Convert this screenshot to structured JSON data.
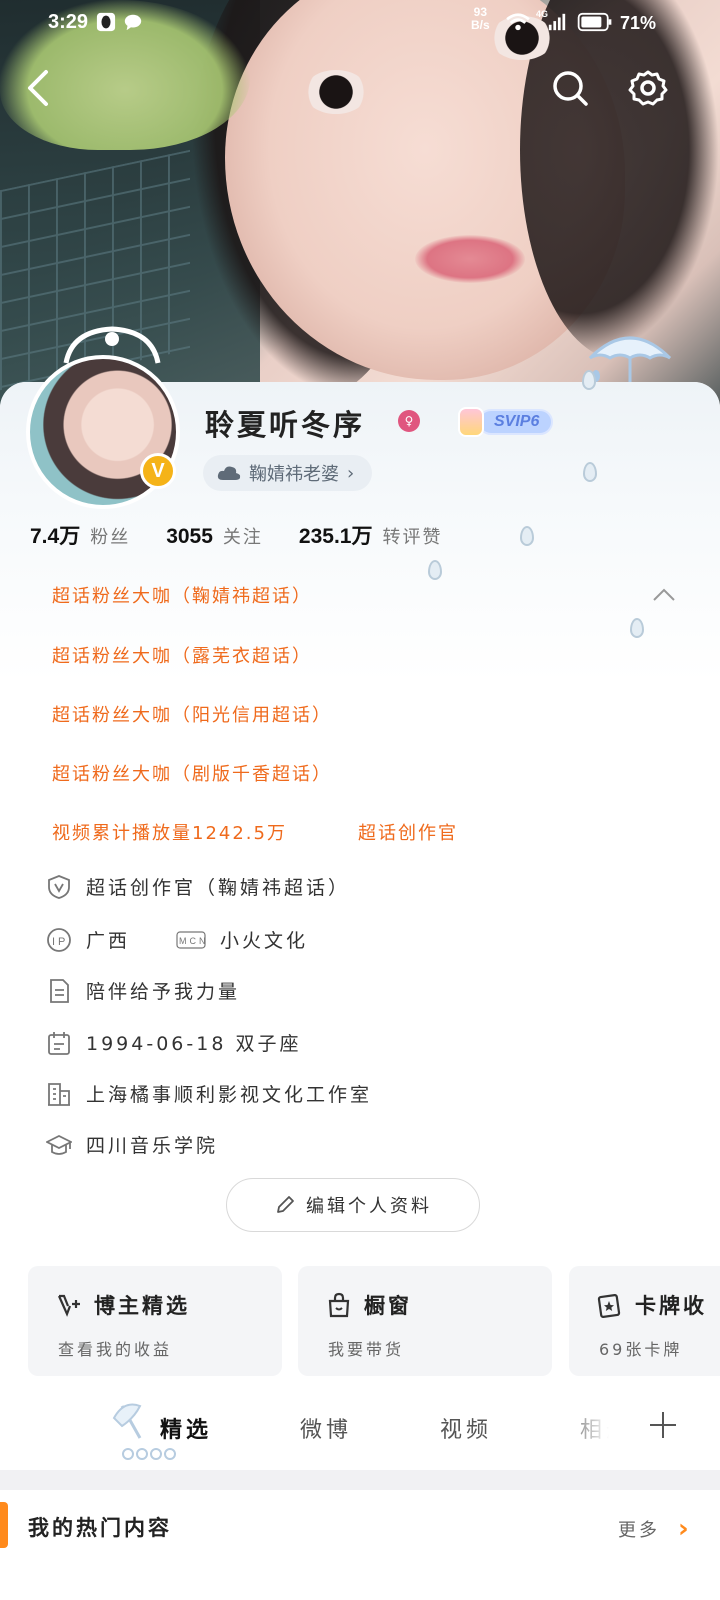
{
  "status_bar": {
    "time": "3:29",
    "net_speed_value": "93",
    "net_speed_unit": "B/s",
    "network_type": "4G",
    "battery": "71%"
  },
  "profile": {
    "username": "聆夏听冬序",
    "vip_label": "SVIP6",
    "verified_mark": "V",
    "group_chip": "鞠婧祎老婆",
    "group_chip_arrow": "›"
  },
  "stats": [
    {
      "value": "7.4万",
      "label": "粉丝"
    },
    {
      "value": "3055",
      "label": "关注"
    },
    {
      "value": "235.1万",
      "label": "转评赞"
    }
  ],
  "badges": [
    "超话粉丝大咖（鞠婧祎超话）",
    "超话粉丝大咖（露芜衣超话）",
    "超话粉丝大咖（阳光信用超话）",
    "超话粉丝大咖（剧版千香超话）"
  ],
  "achievements": {
    "video_plays": "视频累计播放量1242.5万",
    "creator": "超话创作官"
  },
  "info": {
    "creator_line": "超话创作官（鞠婧祎超话）",
    "ip_location": "广西",
    "mcn_label": "MCN",
    "mcn": "小火文化",
    "bio": "陪伴给予我力量",
    "birthday": "1994-06-18 双子座",
    "company": "上海橘事顺利影视文化工作室",
    "school": "四川音乐学院"
  },
  "edit_button": "编辑个人资料",
  "feature_cards": [
    {
      "title": "博主精选",
      "subtitle": "查看我的收益",
      "icon": "v-plus-icon"
    },
    {
      "title": "橱窗",
      "subtitle": "我要带货",
      "icon": "shopping-bag-icon"
    },
    {
      "title": "卡牌收",
      "subtitle": "69张卡牌",
      "icon": "card-star-icon"
    }
  ],
  "tabs": [
    "精选",
    "微博",
    "视频",
    "相册"
  ],
  "hot_section": {
    "title": "我的热门内容",
    "more": "更多",
    "more_arrow": "›"
  },
  "colors": {
    "accent_orange": "#ef6a1c",
    "verified_gold": "#f5b318",
    "svip_blue": "#5b7fe0"
  }
}
